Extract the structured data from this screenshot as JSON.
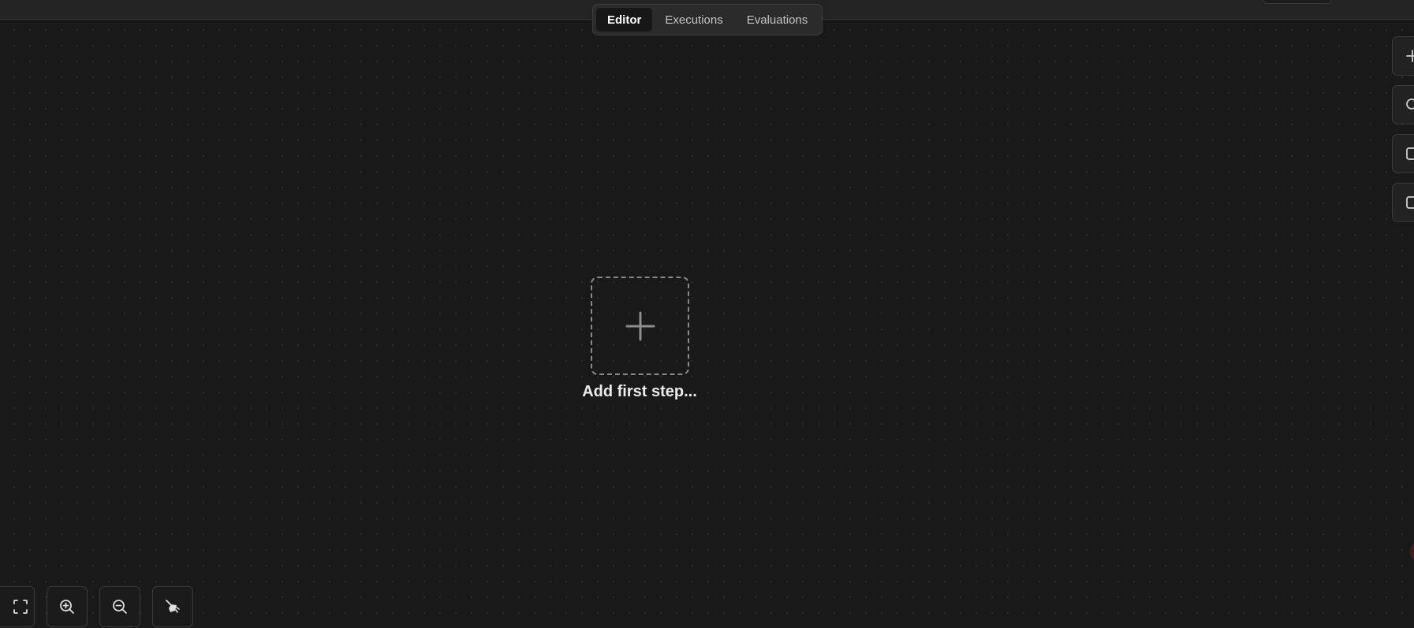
{
  "tabs": [
    {
      "label": "Editor",
      "active": true
    },
    {
      "label": "Executions",
      "active": false
    },
    {
      "label": "Evaluations",
      "active": false
    }
  ],
  "canvas": {
    "add_step_label": "Add first step...",
    "add_step_icon": "plus-icon"
  },
  "right_toolbar": [
    {
      "icon": "plus-icon"
    },
    {
      "icon": "search-icon"
    },
    {
      "icon": "sticky-note-icon"
    },
    {
      "icon": "panel-icon"
    }
  ],
  "bottom_toolbar": [
    {
      "icon": "fit-view-icon"
    },
    {
      "icon": "zoom-in-icon"
    },
    {
      "icon": "zoom-out-icon"
    },
    {
      "icon": "tidy-up-icon"
    }
  ],
  "colors": {
    "background": "#191919",
    "topbar": "#232323",
    "tab_active_bg": "#171717",
    "tab_group_bg": "#2b2b2b",
    "dashed_border": "#8a8a8a"
  }
}
